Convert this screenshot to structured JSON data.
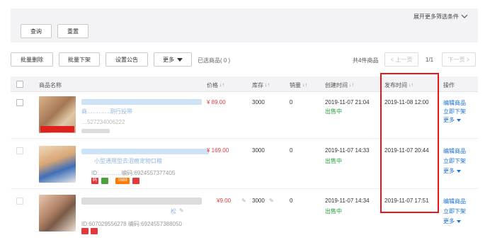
{
  "filter": {
    "expand_label": "展开更多筛选条件",
    "query_label": "查询",
    "reset_label": "重置"
  },
  "toolbar": {
    "batch_delete": "批量删除",
    "batch_delist": "批量下架",
    "set_announcement": "设置公告",
    "more": "更多",
    "selected_count": "已选商品( 0 )",
    "total_count": "共4件商品",
    "prev_page": "< 上一页",
    "page_indicator": "1/1",
    "next_page": "下一页 >"
  },
  "table": {
    "headers": {
      "product_name": "商品名称",
      "price": "价格",
      "stock": "库存",
      "sales": "销量",
      "created_time": "创建时间",
      "published_time": "发布时间",
      "actions": "操作"
    },
    "rows": [
      {
        "title_fragment": "商…………测行投带",
        "id_line": "…527234006222",
        "price": "¥ 89.00",
        "stock": "3000",
        "sales": "0",
        "created_time": "2019-11-07 21:04",
        "status": "出售中",
        "published_time": "2019-11-08 12:00",
        "actions": [
          "编辑商品",
          "立即下架",
          "更多"
        ]
      },
      {
        "title_fragment": "小型通用型去泪痕宠物口粮",
        "id_line": "ID:…………编码:6924557377405",
        "price": "¥ 169.00",
        "stock": "3000",
        "sales": "0",
        "created_time": "2019-11-07 14:33",
        "status": "出售中",
        "published_time": "2019-11-07 20:44",
        "actions": [
          "编辑商品",
          "立即下架",
          "更多"
        ],
        "tags": [
          "码",
          "1688"
        ]
      },
      {
        "title_fragment": "松",
        "id_line": "ID:607029556278 编码:6924557388050",
        "price": "¥9.00",
        "stock": "3000",
        "sales": "0",
        "created_time": "2019-11-07 14:34",
        "status": "出售中",
        "published_time": "2019-11-07 17:51",
        "actions": [
          "编辑商品",
          "立即下架",
          "更多"
        ]
      }
    ]
  },
  "colors": {
    "price": "#e4393c",
    "status": "#21a03a",
    "action_link": "#1a6fd0",
    "highlight": "#e41818"
  }
}
